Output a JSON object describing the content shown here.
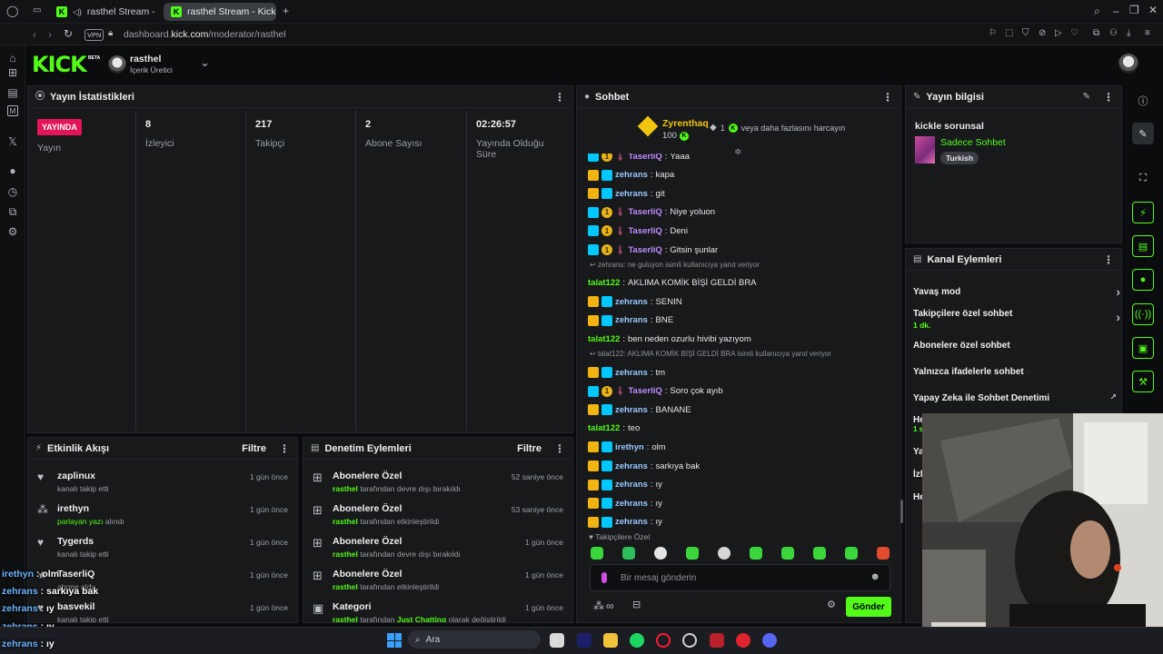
{
  "browser": {
    "tabs": [
      {
        "label": "rasthel Stream - Watc"
      },
      {
        "label": "rasthel Stream - Kick Das"
      }
    ],
    "vpn_badge": "VPN",
    "url_prefix": "dashboard.",
    "url_domain": "kick.com",
    "url_path": "/moderator/rasthel"
  },
  "header": {
    "logo": "KICK",
    "logo_beta": "BETA",
    "channel_name": "rasthel",
    "channel_role": "İçerik Üretici"
  },
  "stats_panel": {
    "title": "Yayın İstatistikleri",
    "live_badge": "YAYINDA",
    "live_label": "Yayın",
    "items": [
      {
        "value": "8",
        "label": "İzleyici"
      },
      {
        "value": "217",
        "label": "Takipçi"
      },
      {
        "value": "2",
        "label": "Abone Sayısı"
      },
      {
        "value": "02:26:57",
        "label": "Yayında Olduğu Süre"
      }
    ]
  },
  "activity_panel": {
    "title": "Etkinlik Akışı",
    "filter": "Filtre",
    "items": [
      {
        "name": "zaplinux",
        "desc": "kanalı takip etti",
        "time": "1 gün önce"
      },
      {
        "name": "irethyn",
        "desc_green": "parlayan yazı",
        "desc": " alındı",
        "time": "1 gün önce"
      },
      {
        "name": "Tygerds",
        "desc": "kanalı takip etti",
        "time": "1 gün önce"
      },
      {
        "name": "TaserliQ",
        "desc": "abone oldu",
        "time": "1 gün önce"
      },
      {
        "name": "basvekil",
        "desc": "kanalı takip etti",
        "time": "1 gün önce"
      }
    ]
  },
  "moderation_panel": {
    "title": "Denetim Eylemleri",
    "filter": "Filtre",
    "items": [
      {
        "title": "Abonelere Özel",
        "actor": "rasthel",
        "desc": " tarafından devre dışı bırakıldı",
        "time": "52 saniye önce"
      },
      {
        "title": "Abonelere Özel",
        "actor": "rasthel",
        "desc": " tarafından etkinleştirildi",
        "time": "53 saniye önce"
      },
      {
        "title": "Abonelere Özel",
        "actor": "rasthel",
        "desc": " tarafından devre dışı bırakıldı",
        "time": "1 gün önce"
      },
      {
        "title": "Abonelere Özel",
        "actor": "rasthel",
        "desc": " tarafından etkinleştirildi",
        "time": "1 gün önce"
      },
      {
        "title": "Kategori",
        "actor": "rasthel",
        "desc": " tarafından ",
        "desc_green": "Just Chatting",
        "desc_end": " olarak değiştirildi",
        "time": "1 gün önce"
      }
    ]
  },
  "chat_panel": {
    "title": "Sohbet",
    "top_user": "Zyrenthaq",
    "top_amount": "100",
    "gift_count": "1",
    "gift_text": "veya daha fazlasını harcayın",
    "messages": [
      {
        "user": "TaserliQ",
        "text": "Yaaa",
        "badges": "tsr"
      },
      {
        "user": "zehrans",
        "text": "kapa",
        "badges": "z"
      },
      {
        "user": "zehrans",
        "text": "git",
        "badges": "z"
      },
      {
        "user": "TaserliQ",
        "text": "Niye yoluon",
        "badges": "tsr"
      },
      {
        "user": "TaserliQ",
        "text": "Deni",
        "badges": "tsr"
      },
      {
        "user": "TaserliQ",
        "text": "Gitsin şunlar",
        "badges": "tsr"
      },
      {
        "reply": "zehrans: ne guluyon isimli kullanıcıya yanıt veriyor"
      },
      {
        "user": "talat122",
        "text": "AKLIMA KOMİK BİŞİ GELDİ BRA",
        "badges": "none"
      },
      {
        "user": "zehrans",
        "text": "SENIN",
        "badges": "z"
      },
      {
        "user": "zehrans",
        "text": "BNE",
        "badges": "z"
      },
      {
        "user": "talat122",
        "text": "ben neden ozurlu hivibi yazıyom",
        "badges": "none"
      },
      {
        "reply": "talat122: AKLIMA KOMİK BİŞİ GELDİ BRA isimli kullanıcıya yanıt veriyor"
      },
      {
        "user": "zehrans",
        "text": "tm",
        "badges": "z"
      },
      {
        "user": "TaserliQ",
        "text": "Soro çok ayıb",
        "badges": "tsr"
      },
      {
        "user": "zehrans",
        "text": "BANANE",
        "badges": "z"
      },
      {
        "user": "talat122",
        "text": "teo",
        "badges": "none"
      },
      {
        "user": "irethyn",
        "text": "olm",
        "badges": "z"
      },
      {
        "user": "zehrans",
        "text": "sarkıya bak",
        "badges": "z"
      },
      {
        "user": "zehrans",
        "text": "ıy",
        "badges": "z"
      },
      {
        "user": "zehrans",
        "text": "ıy",
        "badges": "z"
      },
      {
        "user": "zehrans",
        "text": "ıy",
        "badges": "z"
      }
    ],
    "followers_only": "Takipçilere Özel",
    "input_placeholder": "Bir mesaj gönderin",
    "send_label": "Gönder"
  },
  "stream_info": {
    "title": "Yayın bilgisi",
    "stream_title": "kickle sorunsal",
    "category": "Sadece Sohbet",
    "tag": "Turkish"
  },
  "channel_actions": {
    "title": "Kanal Eylemleri",
    "items": [
      {
        "label": "Yavaş mod"
      },
      {
        "label": "Takipçilere özel sohbet",
        "sub": "1 dk."
      },
      {
        "label": "Abonelere özel sohbet"
      },
      {
        "label": "Yalnızca ifadelerle sohbet"
      },
      {
        "label": "Yapay Zeka ile Sohbet Denetimi"
      }
    ],
    "partial": [
      "He",
      "1 sa",
      "Ya",
      "İzle",
      "He"
    ]
  },
  "overlay_chat": [
    {
      "name": "irethyn",
      "text": " : olm"
    },
    {
      "name": "zehrans",
      "text": " : sarkıya bak"
    },
    {
      "name": "zehrans",
      "text": " : ıy"
    },
    {
      "name": "zehrans",
      "text": " : ıy"
    },
    {
      "name": "zehrans",
      "text": " : ıy"
    }
  ],
  "taskbar": {
    "search": "Ara"
  },
  "colors": {
    "kick_green": "#53fc18",
    "live_red": "#e2155a",
    "panel_bg": "#17191b"
  }
}
